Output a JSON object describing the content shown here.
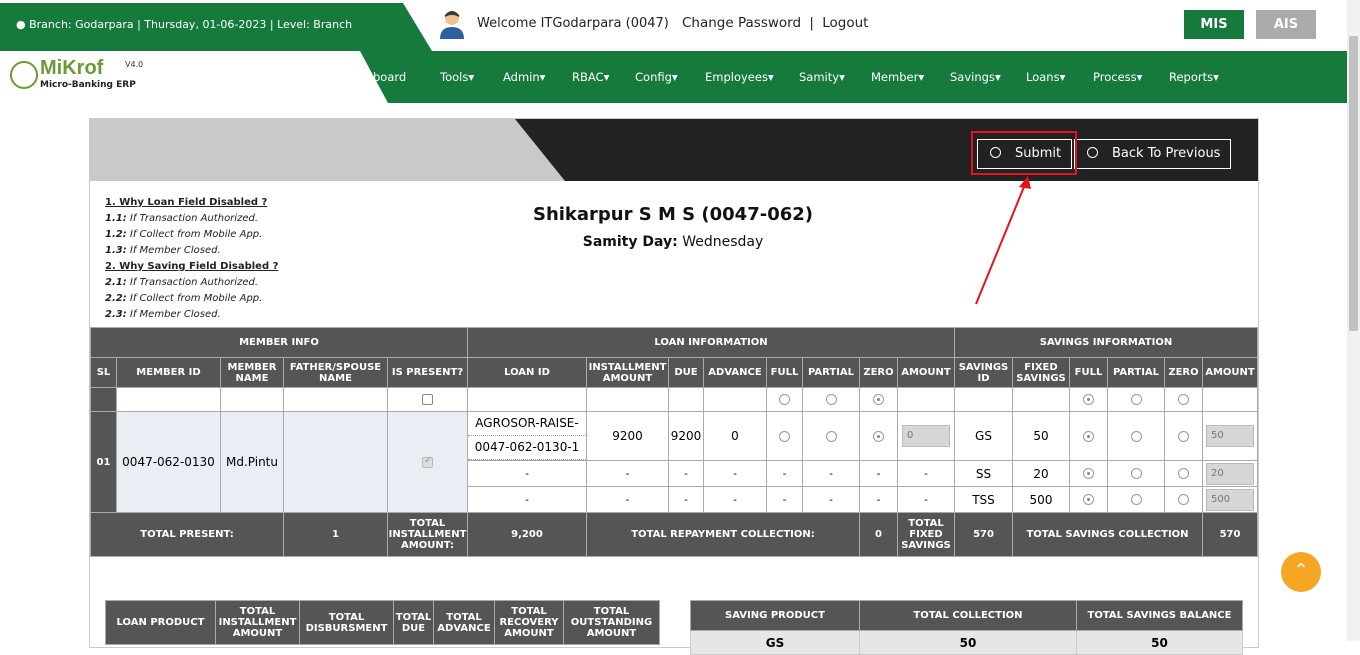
{
  "header": {
    "branch_info": "Branch: Godarpara | Thursday, 01-06-2023 | Level: Branch",
    "welcome": "Welcome ITGodarpara (0047)",
    "change_password": "Change Password",
    "sep": "|",
    "logout": "Logout",
    "mis": "MIS",
    "ais": "AIS"
  },
  "logo": {
    "name": "MiKrof",
    "version": "V4.0",
    "subtitle": "Micro-Banking ERP"
  },
  "nav": {
    "items": [
      "board",
      "Tools",
      "Admin",
      "RBAC",
      "Config",
      "Employees",
      "Samity",
      "Member",
      "Savings",
      "Loans",
      "Process",
      "Reports"
    ]
  },
  "panel": {
    "submit": "Submit",
    "back": "Back To Previous"
  },
  "notes": {
    "h1": "1. Why Loan Field Disabled ?",
    "n11k": "1.1:",
    "n11": " If Transaction Authorized.",
    "n12k": "1.2:",
    "n12": " If Collect from Mobile App.",
    "n13k": "1.3:",
    "n13": " If Member Closed.",
    "h2": "2. Why Saving Field Disabled ?",
    "n21k": "2.1:",
    "n21": " If Transaction Authorized.",
    "n22k": "2.2:",
    "n22": " If Collect from Mobile App.",
    "n23k": "2.3:",
    "n23": " If Member Closed."
  },
  "samity": {
    "title": "Shikarpur S M S (0047-062)",
    "day_label": "Samity Day:",
    "day": "Wednesday"
  },
  "table": {
    "group_member": "MEMBER INFO",
    "group_loan": "LOAN INFORMATION",
    "group_savings": "SAVINGS INFORMATION",
    "h_sl": "SL",
    "h_member_id": "MEMBER ID",
    "h_member_name": "MEMBER NAME",
    "h_father": "FATHER/SPOUSE NAME",
    "h_present": "IS PRESENT?",
    "h_loan_id": "LOAN ID",
    "h_inst": "INSTALLMENT AMOUNT",
    "h_due": "DUE",
    "h_adv": "ADVANCE",
    "h_full": "FULL",
    "h_partial": "PARTIAL",
    "h_zero": "ZERO",
    "h_amount": "AMOUNT",
    "h_sav_id": "SAVINGS ID",
    "h_fixed": "FIXED SAVINGS",
    "h_sfull": "FULL",
    "h_spartial": "PARTIAL",
    "h_szero": "ZERO",
    "h_samount": "AMOUNT",
    "row": {
      "sl": "01",
      "member_id": "0047-062-0130",
      "member_name": "Md.Pintu",
      "loan_id_1": "AGROSOR-RAISE-",
      "loan_id_2": "0047-062-0130-1",
      "inst": "9200",
      "due": "9200",
      "adv": "0",
      "loan_amount": "0",
      "dash": "-",
      "sav1_id": "GS",
      "sav1_fixed": "50",
      "sav1_amount": "50",
      "sav2_id": "SS",
      "sav2_fixed": "20",
      "sav2_amount": "20",
      "sav3_id": "TSS",
      "sav3_fixed": "500",
      "sav3_amount": "500"
    },
    "total": {
      "present_label": "TOTAL PRESENT:",
      "present": "1",
      "inst_label": "TOTAL INSTALLMENT AMOUNT:",
      "inst": "9,200",
      "repay_label": "TOTAL REPAYMENT COLLECTION:",
      "repay": "0",
      "fixed_label": "TOTAL FIXED SAVINGS",
      "fixed": "570",
      "sav_label": "TOTAL SAVINGS COLLECTION",
      "sav": "570"
    }
  },
  "loan_summary": {
    "headers": [
      "LOAN PRODUCT",
      "TOTAL INSTALLMENT AMOUNT",
      "TOTAL DISBURSMENT",
      "TOTAL DUE",
      "TOTAL ADVANCE",
      "TOTAL RECOVERY AMOUNT",
      "TOTAL OUTSTANDING AMOUNT"
    ]
  },
  "saving_summary": {
    "headers": [
      "SAVING PRODUCT",
      "TOTAL COLLECTION",
      "TOTAL SAVINGS BALANCE"
    ],
    "row": [
      "GS",
      "50",
      "50"
    ]
  },
  "fab": "⌃"
}
